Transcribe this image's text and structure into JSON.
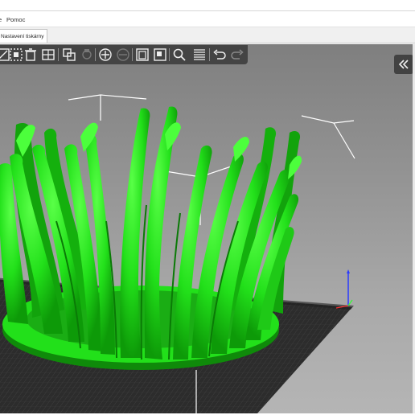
{
  "menubar": {
    "items": [
      "e",
      "Pomoc"
    ]
  },
  "tabs": [
    {
      "label": "Nastavení tiskárny",
      "active": true
    }
  ],
  "toolbar": {
    "buttons": [
      "arrange-icon",
      "select-all-icon",
      "delete-icon",
      "layout-icon",
      "copy-paste-icon",
      "settings-icon",
      "add-instance-icon",
      "remove-instance-icon",
      "split-objects-icon",
      "split-parts-icon",
      "search-icon",
      "layers-icon",
      "undo-icon",
      "redo-icon"
    ]
  },
  "colors": {
    "model": "#22e01a",
    "model_shadow": "#0f8a0a",
    "bed": "#2b2b2b",
    "toolbar": "#373737"
  }
}
